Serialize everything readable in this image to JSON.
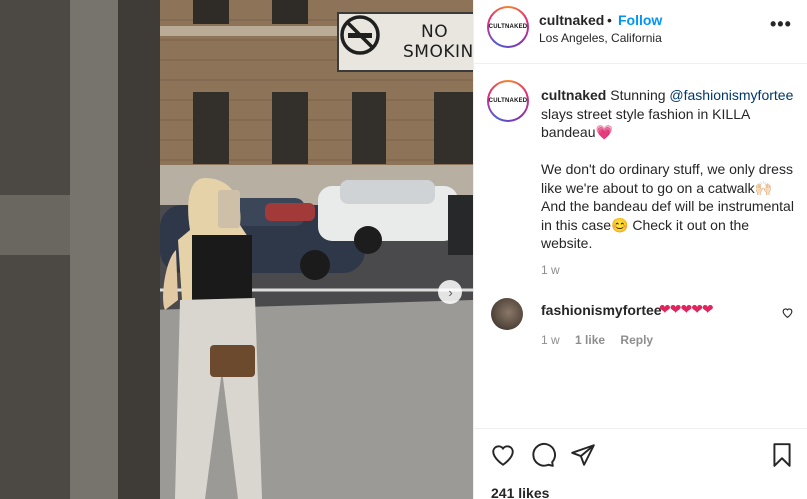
{
  "post": {
    "username": "cultnaked",
    "follow_separator": "•",
    "follow_label": "Follow",
    "location": "Los Angeles, California",
    "more_label": "•••",
    "avatar_text": "CULTNAKED"
  },
  "photo": {
    "sign_line1": "NO",
    "sign_line2": "SMOKING",
    "next_label": "›"
  },
  "caption": {
    "username": "cultnaked",
    "text_before": " Stunning ",
    "mention": "@fashionismyfortee",
    "text_after": " slays street style fashion in KILLA bandeau💗\n\nWe don't do ordinary stuff, we only dress like we're about to go on a catwalk🙌🏻\nAnd the bandeau def will be instrumental in this case😊 Check it out on the website.",
    "time": "1 w"
  },
  "comment": {
    "username": "fashionismyfortee",
    "text": "❤❤❤❤❤",
    "time": "1 w",
    "likes": "1 like",
    "reply_label": "Reply"
  },
  "actions": {
    "likes_count": "241 likes"
  },
  "colors": {
    "link_blue": "#0095f6",
    "mention_blue": "#00376b",
    "meta_gray": "#8e8e8e",
    "heart_red": "#e0245e"
  },
  "icons": [
    "heart-icon",
    "comment-icon",
    "share-icon",
    "bookmark-icon",
    "small-heart-icon",
    "no-smoking-icon",
    "more-options-icon",
    "next-arrow-icon"
  ]
}
